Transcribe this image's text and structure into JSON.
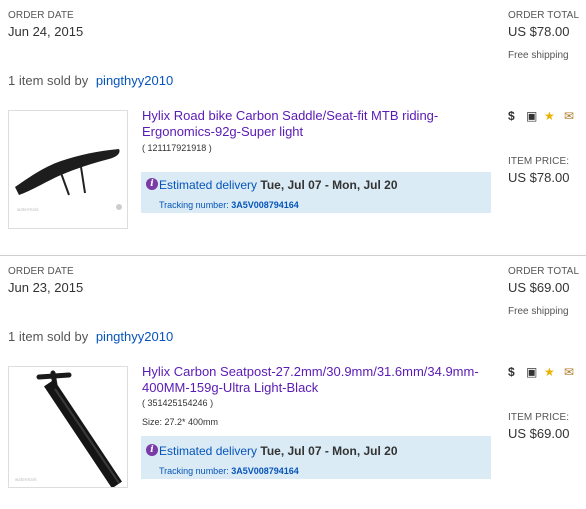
{
  "orders": [
    {
      "order_date_label": "ORDER DATE",
      "order_date": "Jun 24, 2015",
      "order_total_label": "ORDER TOTAL",
      "order_total": "US $78.00",
      "shipping": "Free shipping",
      "seller_prefix": "1 item sold by",
      "seller": "pingthyy2010",
      "item_title_line1": "Hylix Road bike Carbon Saddle/Seat-fit MTB riding-",
      "item_title_line2": "Ergonomics-92g-Super light",
      "item_number": "( 121117921918 )",
      "size": "",
      "delivery_prefix": "Estimated delivery",
      "delivery_dates": "Tue, Jul 07 - Mon, Jul 20",
      "tracking_label": "Tracking number:",
      "tracking_number": "3A5V008794164",
      "item_price_label": "ITEM PRICE:",
      "item_price": "US $78.00",
      "action_icons": [
        "dollar-icon",
        "printer-icon",
        "star-feedback-icon",
        "envelope-icon"
      ],
      "image": "saddle-image"
    },
    {
      "order_date_label": "ORDER DATE",
      "order_date": "Jun 23, 2015",
      "order_total_label": "ORDER TOTAL",
      "order_total": "US $69.00",
      "shipping": "Free shipping",
      "seller_prefix": "1 item sold by",
      "seller": "pingthyy2010",
      "item_title_line1": "Hylix Carbon Seatpost-27.2mm/30.9mm/31.6mm/34.9mm-",
      "item_title_line2": "400MM-159g-Ultra Light-Black",
      "item_number": "( 351425154246 )",
      "size": "Size: 27.2* 400mm",
      "delivery_prefix": "Estimated delivery",
      "delivery_dates": "Tue, Jul 07 - Mon, Jul 20",
      "tracking_label": "Tracking number:",
      "tracking_number": "3A5V008794164",
      "item_price_label": "ITEM PRICE:",
      "item_price": "US $69.00",
      "action_icons": [
        "dollar-icon",
        "printer-icon",
        "star-feedback-icon",
        "envelope-icon"
      ],
      "image": "seatpost-image"
    }
  ]
}
